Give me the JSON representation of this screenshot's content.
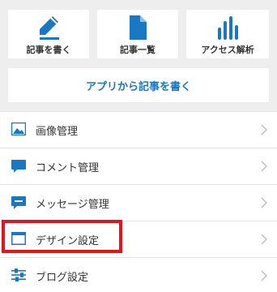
{
  "actions": {
    "write": "記事を書く",
    "list": "記事一覧",
    "analytics": "アクセス解析",
    "app_write": "アプリから記事を書く"
  },
  "menu": [
    {
      "label": "画像管理",
      "icon": "image-icon"
    },
    {
      "label": "コメント管理",
      "icon": "comment-icon"
    },
    {
      "label": "メッセージ管理",
      "icon": "message-icon"
    },
    {
      "label": "デザイン設定",
      "icon": "window-icon",
      "highlighted": true
    },
    {
      "label": "ブログ設定",
      "icon": "sliders-icon"
    }
  ],
  "colors": {
    "accent": "#1a78c2",
    "background": "#eeeeee",
    "highlight": "#e4141f"
  }
}
